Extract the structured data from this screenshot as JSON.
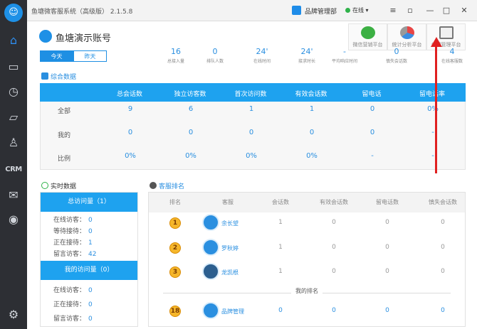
{
  "window": {
    "title": "鱼塘微客服系统（高级版） 2.1.5.8",
    "user": "品牌管理部",
    "status": "在线"
  },
  "sidebar": {
    "logo": "☺",
    "crm_label": "CRM"
  },
  "account": {
    "name": "鱼塘演示账号"
  },
  "toolbar": {
    "wechat_marketing": "微信营销平台",
    "stats_analysis": "统计分析平台",
    "company_management": "公司管理平台"
  },
  "tabs": {
    "today": "今天",
    "yesterday": "昨天"
  },
  "stats": [
    {
      "value": "16",
      "label": "总接入量"
    },
    {
      "value": "0",
      "label": "排队人数"
    },
    {
      "value": "24'",
      "label": "在线时间"
    },
    {
      "value": "24'",
      "label": "接求时长"
    },
    {
      "value": "-",
      "label": "平均响应时间"
    },
    {
      "value": "0",
      "label": "慎失会话数"
    },
    {
      "value": "4",
      "label": "在线客服数"
    }
  ],
  "summary": {
    "title": "综合数据",
    "columns": [
      "总会话数",
      "独立访客数",
      "首次访问数",
      "有效会话数",
      "留电话",
      "留电话率"
    ],
    "rows": [
      {
        "label": "全部",
        "values": [
          "9",
          "6",
          "1",
          "1",
          "0",
          "0%"
        ]
      },
      {
        "label": "我的",
        "values": [
          "0",
          "0",
          "0",
          "0",
          "0",
          "-"
        ]
      },
      {
        "label": "比例",
        "values": [
          "0%",
          "0%",
          "0%",
          "0%",
          "-",
          "-"
        ]
      }
    ]
  },
  "realtime": {
    "title": "实时数据",
    "total_header": "总访问量（1）",
    "total_rows": [
      {
        "label": "在线访客：",
        "value": "0"
      },
      {
        "label": "等待接待：",
        "value": "0"
      },
      {
        "label": "正在接待：",
        "value": "1"
      },
      {
        "label": "留言访客：",
        "value": "42"
      }
    ],
    "mine_header": "我的访问量（0）",
    "mine_rows": [
      {
        "label": "在线访客：",
        "value": "0"
      },
      {
        "label": "正在接待：",
        "value": "0"
      },
      {
        "label": "留言访客：",
        "value": "0"
      }
    ]
  },
  "ranking": {
    "title": "客服排名",
    "columns": [
      "排名",
      "客服",
      "会话数",
      "有效会话数",
      "留电话数",
      "慎失会话数"
    ],
    "rows": [
      {
        "rank": "1",
        "name": "余长望",
        "values": [
          "1",
          "0",
          "0",
          "0"
        ]
      },
      {
        "rank": "2",
        "name": "罗秋婷",
        "values": [
          "1",
          "0",
          "0",
          "0"
        ]
      },
      {
        "rank": "3",
        "name": "龙凯根",
        "values": [
          "1",
          "0",
          "0",
          "0"
        ]
      }
    ],
    "my_rank_label": "我的排名",
    "my_row": {
      "rank": "18",
      "name": "品牌管理",
      "values": [
        "0",
        "0",
        "0",
        "0"
      ]
    }
  },
  "colors": {
    "accent": "#1ea2ef",
    "annotation_arrow": "#e02020"
  }
}
